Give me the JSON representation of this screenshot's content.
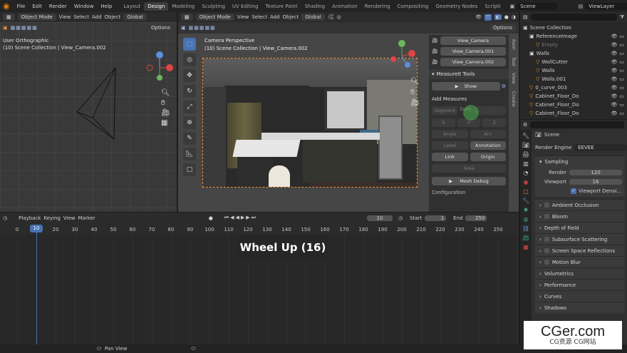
{
  "top_menu": [
    "File",
    "Edit",
    "Render",
    "Window",
    "Help"
  ],
  "workspaces": [
    {
      "label": "Layout",
      "active": false
    },
    {
      "label": "Design",
      "active": true
    },
    {
      "label": "Modeling",
      "active": false
    },
    {
      "label": "Sculpting",
      "active": false
    },
    {
      "label": "UV Editing",
      "active": false
    },
    {
      "label": "Texture Paint",
      "active": false
    },
    {
      "label": "Shading",
      "active": false
    },
    {
      "label": "Animation",
      "active": false
    },
    {
      "label": "Rendering",
      "active": false
    },
    {
      "label": "Compositing",
      "active": false
    },
    {
      "label": "Geometry Nodes",
      "active": false
    },
    {
      "label": "Scripti",
      "active": false
    }
  ],
  "scene_name": "Scene",
  "view_layer": "ViewLayer",
  "left_viewport": {
    "mode": "Object Mode",
    "menus": [
      "View",
      "Select",
      "Add",
      "Object"
    ],
    "transform": "Global",
    "options": "Options",
    "view_name": "User Orthographic",
    "collection": "(10) Scene Collection | View_Camera.002"
  },
  "camera_viewport": {
    "mode": "Object Mode",
    "menus": [
      "View",
      "Select",
      "Add",
      "Object"
    ],
    "transform": "Global",
    "options": "Options",
    "view_name": "Camera Perspective",
    "collection": "(10) Scene Collection | View_Camera.002"
  },
  "npanel": {
    "cameras": [
      "View_Camera",
      "View_Camera.001",
      "View_Camera.002"
    ],
    "section_title": "MeasureIt Tools",
    "show_label": "Show",
    "add_measures_label": "Add Measures",
    "segment_label": "Segment",
    "sum_label": "Sum:",
    "sum_value": "-",
    "axis_buttons": [
      "X",
      "Y",
      "Z"
    ],
    "angle_label": "Angle",
    "arc_label": "Arc",
    "label_label": "Label",
    "annotation_label": "Annotation",
    "link_label": "Link",
    "origin_label": "Origin",
    "area_label": "Area",
    "mesh_debug_label": "Mesh Debug",
    "config_label": "Configuration",
    "tabs": [
      "Item",
      "Tool",
      "View",
      "Create"
    ]
  },
  "outliner": {
    "root": "Scene Collection",
    "rows": [
      {
        "label": "ReferenceImage",
        "indent": 1
      },
      {
        "label": "Empty",
        "indent": 2
      },
      {
        "label": "Walls",
        "indent": 1
      },
      {
        "label": "WallCutter",
        "indent": 2
      },
      {
        "label": "Walls",
        "indent": 2
      },
      {
        "label": "Walls.001",
        "indent": 2
      },
      {
        "label": "0_curve_003",
        "indent": 1
      },
      {
        "label": "Cabinet_Floor_Do",
        "indent": 1
      },
      {
        "label": "Cabinet_Floor_Do",
        "indent": 1
      },
      {
        "label": "Cabinet_Floor_Do",
        "indent": 1
      }
    ]
  },
  "properties": {
    "scene_label": "Scene",
    "render_engine_label": "Render Engine",
    "render_engine_value": "EEVEE",
    "sampling_label": "Sampling",
    "render_label": "Render",
    "render_value": "120",
    "viewport_label": "Viewport",
    "viewport_value": "16",
    "viewport_denoise_label": "Viewport Denoi...",
    "panels": [
      "Ambient Occlusion",
      "Bloom",
      "Depth of Field",
      "Subsurface Scattering",
      "Screen Space Reflections",
      "Motion Blur",
      "Volumetrics",
      "Performance",
      "Curves",
      "Shadows"
    ]
  },
  "timeline": {
    "menus": [
      "Playback",
      "Keying",
      "View",
      "Marker"
    ],
    "current_frame": "10",
    "start_label": "Start",
    "start_value": "1",
    "end_label": "End",
    "end_value": "250",
    "ticks": [
      "0",
      "10",
      "20",
      "30",
      "40",
      "50",
      "60",
      "70",
      "80",
      "90",
      "100",
      "110",
      "120",
      "130",
      "140",
      "150",
      "160",
      "170",
      "180",
      "190",
      "200",
      "210",
      "220",
      "230",
      "240",
      "250"
    ]
  },
  "overlay_popup": "Wheel Up (16)",
  "status_bar": {
    "pan_view": "Pan View"
  },
  "watermark": {
    "main": "CGer.com",
    "sub": "CG资源 CG网站"
  }
}
